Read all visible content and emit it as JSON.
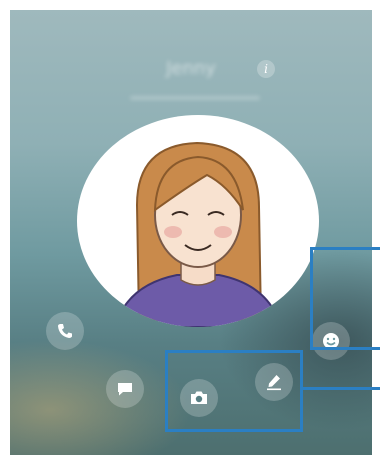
{
  "contact": {
    "name": "Jenny"
  },
  "icons": {
    "info": "info-icon",
    "call": "phone-icon",
    "message": "message-icon",
    "emoji": "smiley-icon",
    "camera": "camera-icon",
    "draw": "pen-icon"
  },
  "colors": {
    "highlight": "#2b7fc3",
    "avatar_shirt": "#6d5ba8",
    "avatar_hair": "#c98a4b"
  }
}
